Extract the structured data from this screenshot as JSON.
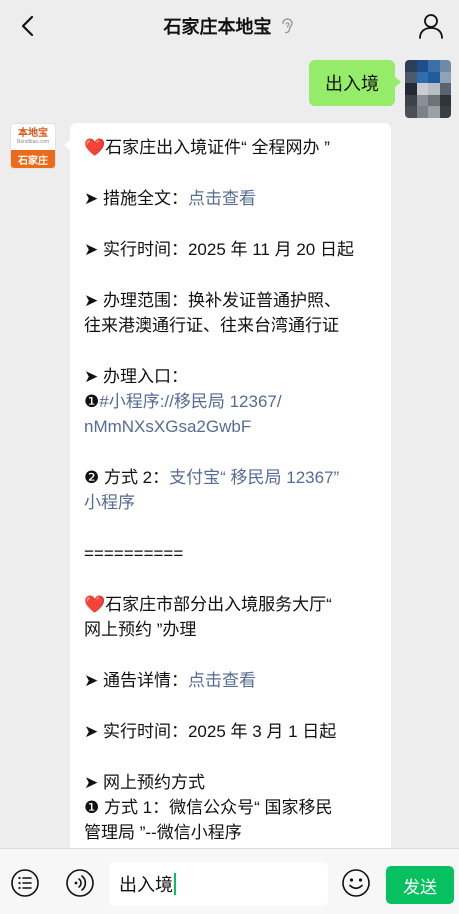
{
  "header": {
    "title": "石家庄本地宝"
  },
  "my_message": {
    "text": "出入境"
  },
  "bot_avatar": {
    "logo_text": "本地宝",
    "logo_sub": "Bendibao.com",
    "city": "石家庄"
  },
  "bot_message": {
    "s1_title": "石家庄出入境证件“ 全程网办 ”",
    "s1_measure_label": "➤ 措施全文：",
    "s1_measure_link": "点击查看",
    "s1_time": "➤ 实行时间：2025 年 11 月 20 日起",
    "s1_scope_1": "➤ 办理范围：换补发证普通护照、",
    "s1_scope_2": "往来港澳通行证、往来台湾通行证",
    "s1_entry": "➤ 办理入口：",
    "s1_way1_num": "❶",
    "s1_way1_link_1": "#小程序://移民局 12367/",
    "s1_way1_link_2": "nMmNXsXGsa2GwbF",
    "s1_way2_label": "❷ 方式 2：",
    "s1_way2_link_1": "支付宝“ 移民局 12367”",
    "s1_way2_link_2": "小程序",
    "divider": "==========",
    "s2_title_1": "石家庄市部分出入境服务大厅“",
    "s2_title_2": "网上预约 ”办理",
    "s2_notice_label": "➤ 通告详情：",
    "s2_notice_link": "点击查看",
    "s2_time": "➤ 实行时间：2025 年 3 月 1 日起",
    "s2_method": "➤ 网上预约方式",
    "s2_way1_1": "❶ 方式 1：微信公众号“ 国家移民",
    "s2_way1_2": "管理局 ”--微信小程序"
  },
  "input_bar": {
    "value": "出入境",
    "send_label": "发送"
  },
  "colors": {
    "accent_green": "#07c160",
    "bubble_green": "#95ec69",
    "link_blue": "#576b95",
    "heart_red": "#e02e3a"
  },
  "icons": {
    "back": "chevron-left-icon",
    "ear": "ear-icon",
    "profile": "user-icon",
    "menu": "menu-list-icon",
    "voice": "voice-icon",
    "emoji": "emoji-icon"
  }
}
